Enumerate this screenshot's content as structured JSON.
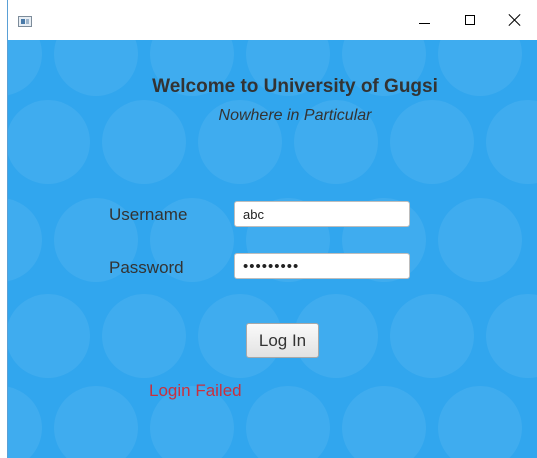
{
  "window": {
    "app_icon": "app-window-icon",
    "controls": {
      "minimize_icon": "minimize-icon",
      "maximize_icon": "maximize-icon",
      "close_icon": "close-icon"
    }
  },
  "header": {
    "title": "Welcome to University of Gugsi",
    "subtitle": "Nowhere in Particular"
  },
  "form": {
    "username_label": "Username",
    "username_value": "abc",
    "password_label": "Password",
    "password_value": "•••••••••",
    "login_button_label": "Log In"
  },
  "status": {
    "message": "Login Failed",
    "color": "#c8303f"
  },
  "colors": {
    "background": "#31a6ee",
    "text": "#333333"
  }
}
